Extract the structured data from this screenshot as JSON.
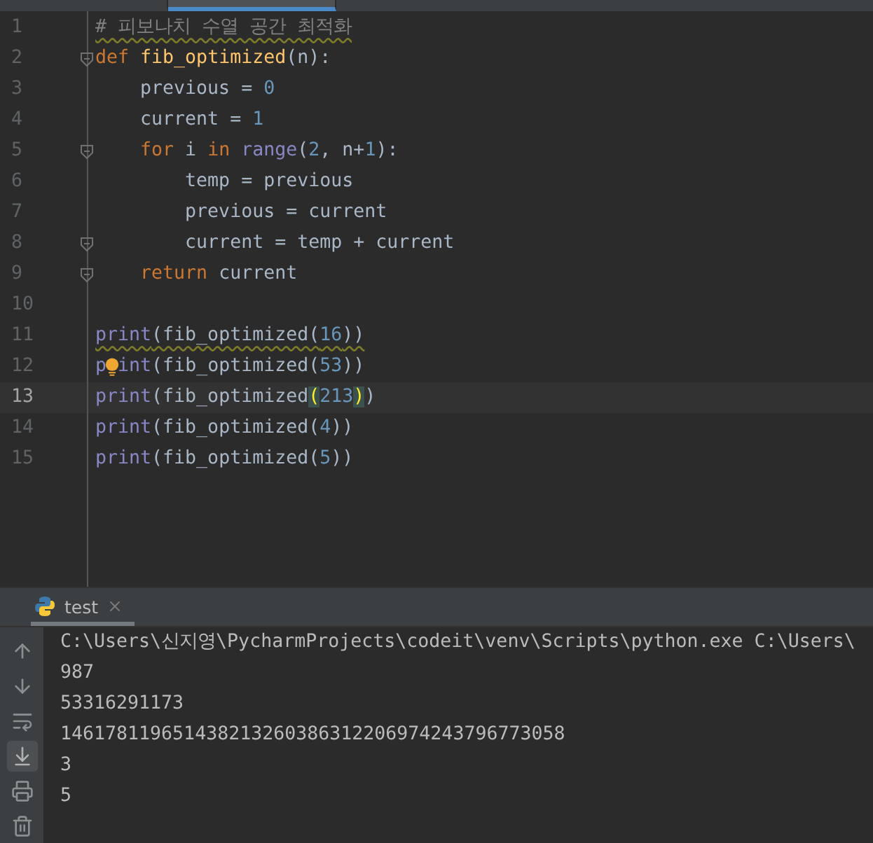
{
  "editor_tabs": [
    {
      "selected": false
    },
    {
      "selected": true
    }
  ],
  "code_lines": [
    {
      "number": "1",
      "current": false,
      "warning": true,
      "tokens": [
        {
          "kind": "comment",
          "text": "# 피보나치 수열 공간 최적화"
        }
      ]
    },
    {
      "number": "2",
      "current": false,
      "fold": true,
      "tokens": [
        {
          "kind": "keyword",
          "text": "def "
        },
        {
          "kind": "funcname",
          "text": "fib_optimized"
        },
        {
          "kind": "plain",
          "text": "(n):"
        }
      ]
    },
    {
      "number": "3",
      "current": false,
      "tokens": [
        {
          "kind": "plain",
          "text": "    previous = "
        },
        {
          "kind": "number",
          "text": "0"
        }
      ]
    },
    {
      "number": "4",
      "current": false,
      "tokens": [
        {
          "kind": "plain",
          "text": "    current = "
        },
        {
          "kind": "number",
          "text": "1"
        }
      ]
    },
    {
      "number": "5",
      "current": false,
      "fold": true,
      "tokens": [
        {
          "kind": "keyword",
          "text": "    for "
        },
        {
          "kind": "plain",
          "text": "i "
        },
        {
          "kind": "keyword",
          "text": "in "
        },
        {
          "kind": "builtin",
          "text": "range"
        },
        {
          "kind": "plain",
          "text": "("
        },
        {
          "kind": "number",
          "text": "2"
        },
        {
          "kind": "plain",
          "text": ", n+"
        },
        {
          "kind": "number",
          "text": "1"
        },
        {
          "kind": "plain",
          "text": "):"
        }
      ]
    },
    {
      "number": "6",
      "current": false,
      "tokens": [
        {
          "kind": "plain",
          "text": "        temp = previous"
        }
      ]
    },
    {
      "number": "7",
      "current": false,
      "tokens": [
        {
          "kind": "plain",
          "text": "        previous = current"
        }
      ]
    },
    {
      "number": "8",
      "current": false,
      "fold": true,
      "tokens": [
        {
          "kind": "plain",
          "text": "        current = temp + current"
        }
      ]
    },
    {
      "number": "9",
      "current": false,
      "fold": true,
      "tokens": [
        {
          "kind": "keyword",
          "text": "    return "
        },
        {
          "kind": "plain",
          "text": "current"
        }
      ]
    },
    {
      "number": "10",
      "current": false
    },
    {
      "number": "11",
      "current": false,
      "warning": true,
      "tokens": [
        {
          "kind": "builtin",
          "text": "print"
        },
        {
          "kind": "plain",
          "text": "(fib_optimized("
        },
        {
          "kind": "number",
          "text": "16"
        },
        {
          "kind": "plain",
          "text": "))"
        }
      ]
    },
    {
      "number": "12",
      "current": false,
      "bulb": true,
      "tokens": [
        {
          "kind": "builtin",
          "text": "p"
        },
        {
          "kind": "builtin",
          "text": "int"
        },
        {
          "kind": "plain",
          "text": "(fib_optimized("
        },
        {
          "kind": "number",
          "text": "53"
        },
        {
          "kind": "plain",
          "text": "))"
        }
      ]
    },
    {
      "number": "13",
      "current": true,
      "tokens": [
        {
          "kind": "builtin",
          "text": "print"
        },
        {
          "kind": "plain",
          "text": "(fib_optimized"
        },
        {
          "kind": "match",
          "text": "("
        },
        {
          "kind": "number",
          "text": "213"
        },
        {
          "kind": "match",
          "text": ")"
        },
        {
          "kind": "plain",
          "text": ")"
        }
      ]
    },
    {
      "number": "14",
      "current": false,
      "tokens": [
        {
          "kind": "builtin",
          "text": "print"
        },
        {
          "kind": "plain",
          "text": "(fib_optimized("
        },
        {
          "kind": "number",
          "text": "4"
        },
        {
          "kind": "plain",
          "text": "))"
        }
      ]
    },
    {
      "number": "15",
      "current": false,
      "tokens": [
        {
          "kind": "builtin",
          "text": "print"
        },
        {
          "kind": "plain",
          "text": "(fib_optimized("
        },
        {
          "kind": "number",
          "text": "5"
        },
        {
          "kind": "plain",
          "text": "))"
        }
      ]
    }
  ],
  "run_tab": {
    "label": "test",
    "selected": true
  },
  "console_tools": [
    {
      "kind": "up",
      "selected": false
    },
    {
      "kind": "down",
      "selected": false
    },
    {
      "kind": "wrap",
      "selected": false
    },
    {
      "kind": "scroll-end",
      "selected": true
    },
    {
      "kind": "print",
      "selected": false
    },
    {
      "kind": "trash",
      "selected": false
    }
  ],
  "console_lines": [
    "C:\\Users\\신지영\\PycharmProjects\\codeit\\venv\\Scripts\\python.exe C:\\Users\\",
    "987",
    "53316291173",
    "146178119651438213260386312206974243796773058",
    "3",
    "5"
  ]
}
